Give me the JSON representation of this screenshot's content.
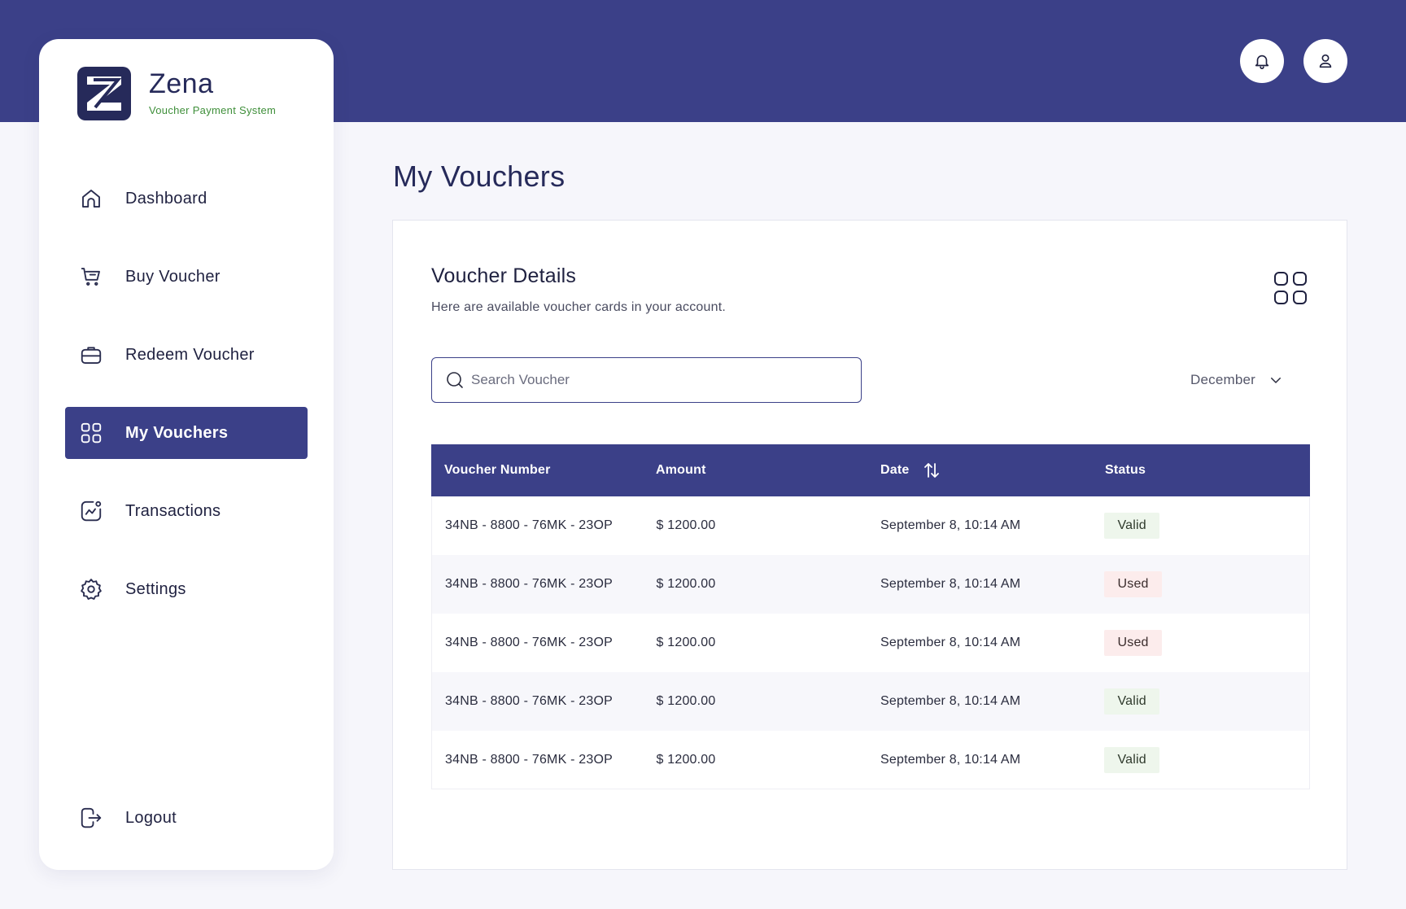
{
  "brand": {
    "name": "Zena",
    "tagline": "Voucher Payment System"
  },
  "header": {
    "notifications_icon": "bell-icon",
    "profile_icon": "user-icon"
  },
  "sidebar": {
    "items": [
      {
        "label": "Dashboard",
        "icon": "home-icon"
      },
      {
        "label": "Buy Voucher",
        "icon": "cart-icon"
      },
      {
        "label": "Redeem Voucher",
        "icon": "briefcase-icon"
      },
      {
        "label": "My Vouchers",
        "icon": "grid-icon",
        "active": true
      },
      {
        "label": "Transactions",
        "icon": "chart-icon"
      },
      {
        "label": "Settings",
        "icon": "gear-icon"
      }
    ],
    "logout": {
      "label": "Logout",
      "icon": "logout-icon"
    }
  },
  "page": {
    "title": "My Vouchers"
  },
  "card": {
    "title": "Voucher Details",
    "subtitle": "Here are available voucher cards in your account.",
    "search": {
      "placeholder": "Search Voucher",
      "value": ""
    },
    "month_filter": {
      "selected": "December"
    }
  },
  "table": {
    "columns": [
      "Voucher Number",
      "Amount",
      "Date",
      "Status"
    ],
    "rows": [
      {
        "number": "34NB - 8800 - 76MK - 23OP",
        "amount": "$ 1200.00",
        "date": "September 8, 10:14 AM",
        "status": "Valid"
      },
      {
        "number": "34NB - 8800 - 76MK - 23OP",
        "amount": "$ 1200.00",
        "date": "September 8, 10:14 AM",
        "status": "Used"
      },
      {
        "number": "34NB - 8800 - 76MK - 23OP",
        "amount": "$ 1200.00",
        "date": "September 8, 10:14 AM",
        "status": "Used"
      },
      {
        "number": "34NB - 8800 - 76MK - 23OP",
        "amount": "$ 1200.00",
        "date": "September 8, 10:14 AM",
        "status": "Valid"
      },
      {
        "number": "34NB - 8800 - 76MK - 23OP",
        "amount": "$ 1200.00",
        "date": "September 8, 10:14 AM",
        "status": "Valid"
      }
    ]
  },
  "colors": {
    "primary": "#3b4088",
    "background": "#f6f6fb",
    "valid_badge_bg": "#eef6ec",
    "used_badge_bg": "#fcecec",
    "tagline": "#3f8f3a"
  }
}
